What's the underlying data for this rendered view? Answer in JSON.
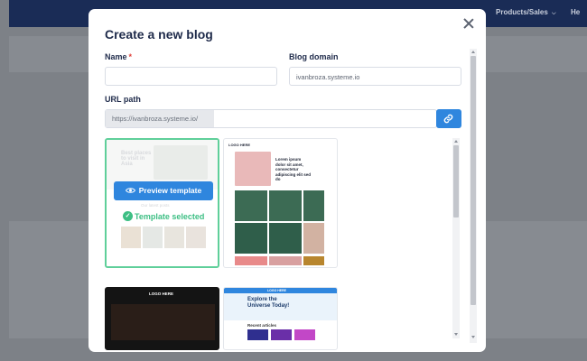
{
  "app": {
    "nav": [
      "Products/Sales",
      "He"
    ],
    "nav_chevron": "chevron-down-icon"
  },
  "modal": {
    "title": "Create a new blog",
    "close_icon": "close-icon"
  },
  "form": {
    "name_label": "Name",
    "name_required_mark": "*",
    "name_value": "",
    "domain_label": "Blog domain",
    "domain_value": "ivanbroza.systeme.io",
    "url_label": "URL path",
    "url_prefix": "https://ivanbroza.systeme.io/",
    "url_value": "",
    "link_icon": "link-icon"
  },
  "templates": {
    "preview_label": "Preview template",
    "selected_label": "Template selected",
    "items": [
      {
        "id": "t1",
        "state": "selected",
        "hero_text": "Best places to visit in Asia",
        "sub_text": "Our latest posts"
      },
      {
        "id": "t2",
        "state": "default",
        "logo": "LOGO HERE",
        "hero_text": "Lorem ipsum dolor sit amet, consectetur adipiscing elit sed do"
      },
      {
        "id": "t3",
        "state": "default",
        "logo": "LOGO HERE"
      },
      {
        "id": "t4",
        "state": "default",
        "logo": "LOGO HERE",
        "hero_text": "Explore the Universe Today!",
        "section": "Recent articles"
      }
    ]
  },
  "colors": {
    "primary": "#2f86de",
    "selected": "#3dbf84",
    "header": "#1a2c56",
    "title": "#1e2a4a"
  }
}
